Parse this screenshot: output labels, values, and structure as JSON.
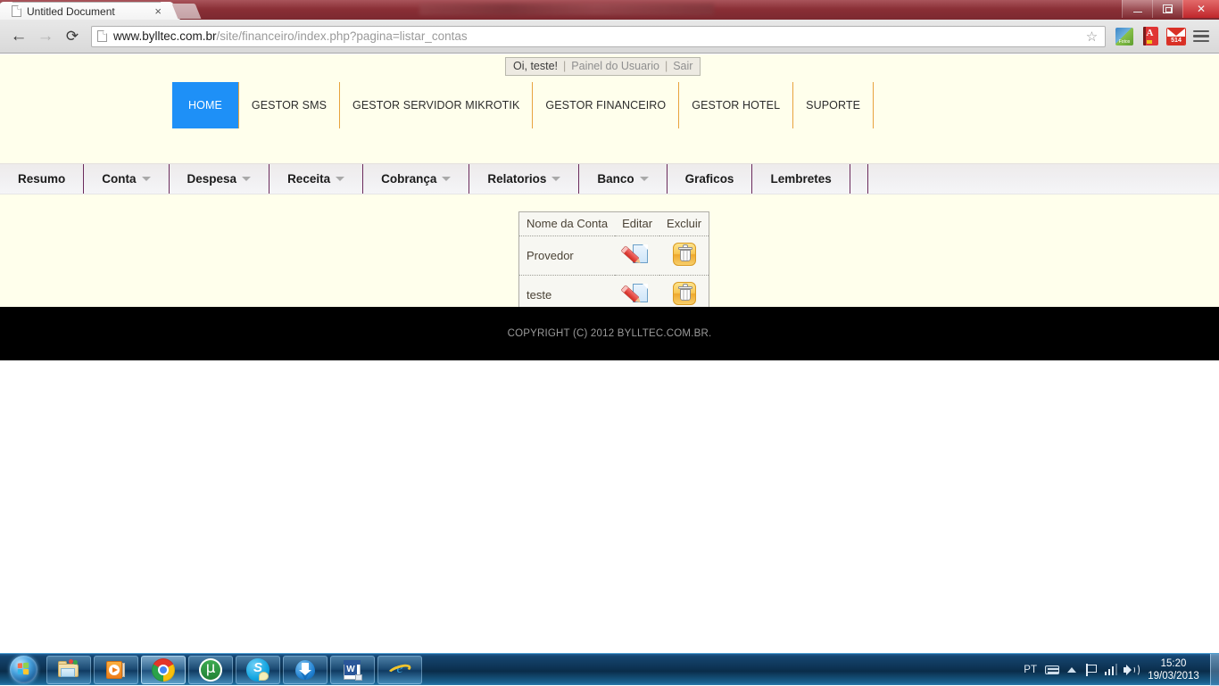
{
  "browser": {
    "tab_title": "Untitled Document",
    "tab_close": "×",
    "back_icon": "←",
    "forward_icon": "→",
    "reload_icon": "⟳",
    "url_host": "www.bylltec.com.br",
    "url_path": "/site/financeiro/index.php?pagina=listar_contas",
    "star_icon": "☆",
    "extensions": [
      "photo-extension-icon",
      "dictionary-extension-icon",
      "gmail-extension-icon"
    ],
    "gmail_badge": "514",
    "menu_icon": "hamburger-menu-icon",
    "window_buttons": {
      "minimize": "–",
      "maximize": "❐",
      "close": "✕"
    }
  },
  "userbar": {
    "greeting": "Oi, teste!",
    "separator": "|",
    "panel_link": "Painel do Usuario",
    "logout_link": "Sair"
  },
  "topnav": {
    "items": [
      {
        "label": "HOME",
        "active": true
      },
      {
        "label": "GESTOR SMS",
        "active": false
      },
      {
        "label": "GESTOR SERVIDOR MIKROTIK",
        "active": false
      },
      {
        "label": "GESTOR FINANCEIRO",
        "active": false
      },
      {
        "label": "GESTOR HOTEL",
        "active": false
      },
      {
        "label": "SUPORTE",
        "active": false
      }
    ]
  },
  "subnav": {
    "items": [
      {
        "label": "Resumo",
        "has_caret": false
      },
      {
        "label": "Conta",
        "has_caret": true
      },
      {
        "label": "Despesa",
        "has_caret": true
      },
      {
        "label": "Receita",
        "has_caret": true
      },
      {
        "label": "Cobrança",
        "has_caret": true
      },
      {
        "label": "Relatorios",
        "has_caret": true
      },
      {
        "label": "Banco",
        "has_caret": true
      },
      {
        "label": "Graficos",
        "has_caret": false
      },
      {
        "label": "Lembretes",
        "has_caret": false
      }
    ]
  },
  "table": {
    "headers": [
      "Nome da Conta",
      "Editar",
      "Excluir"
    ],
    "rows": [
      {
        "nome": "Provedor",
        "edit_icon": "edit-pencil-icon",
        "delete_icon": "trash-can-icon"
      },
      {
        "nome": "teste",
        "edit_icon": "edit-pencil-icon",
        "delete_icon": "trash-can-icon"
      }
    ]
  },
  "footer": {
    "copyright": "COPYRIGHT (C) 2012 BYLLTEC.COM.BR."
  },
  "taskbar": {
    "start_label": "start-orb",
    "buttons": [
      "windows-explorer-icon",
      "windows-media-player-icon",
      "google-chrome-icon",
      "utorrent-icon",
      "skype-icon",
      "download-manager-icon",
      "microsoft-word-icon",
      "internet-explorer-icon"
    ],
    "tray": {
      "language": "PT",
      "icons": [
        "keyboard-icon",
        "show-hidden-icons-arrow",
        "action-flag-icon",
        "network-signal-icon",
        "volume-speaker-icon"
      ],
      "time": "15:20",
      "date": "19/03/2013"
    }
  },
  "colors": {
    "page_bg": "#ffffec",
    "active_nav": "#1e90f7",
    "nav_separator": "#e8a33d",
    "subnav_separator": "#6b2b5c",
    "footer_bg": "#000000",
    "delete_icon": "#f8c653",
    "edit_pencil": "#d32a20"
  }
}
